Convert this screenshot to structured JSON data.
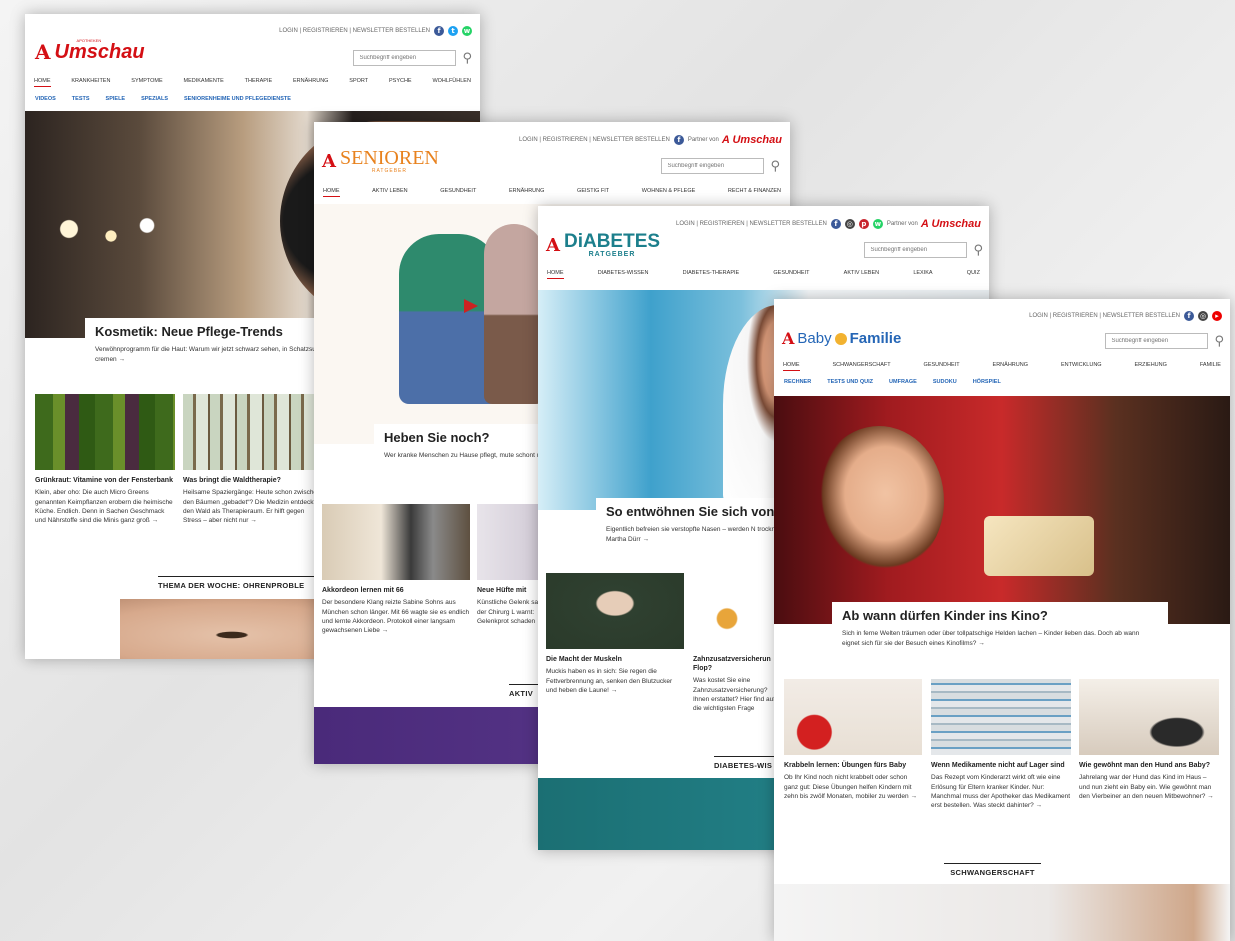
{
  "umschau": {
    "util": "LOGIN | REGISTRIEREN | NEWSLETTER BESTELLEN",
    "logo_small": "APOTHEKEN",
    "logo": "Umschau",
    "search_placeholder": "Suchbegriff eingeben",
    "nav": [
      "HOME",
      "KRANKHEITEN",
      "SYMPTOME",
      "MEDIKAMENTE",
      "THERAPIE",
      "ERNÄHRUNG",
      "SPORT",
      "PSYCHE",
      "WOHLFÜHLEN"
    ],
    "subnav": [
      "VIDEOS",
      "TESTS",
      "SPIELE",
      "SPEZIALS",
      "SENIORENHEIME UND PFLEGEDIENSTE"
    ],
    "hero_title": "Kosmetik: Neue Pflege-Trends",
    "hero_text": "Verwöhnprogramm für die Haut: Warum wir jetzt schwarz sehen, in Schatzsuche gehen können und Wirkstoffe trinken statt cremen →",
    "cards": [
      {
        "title": "Grünkraut: Vitamine von der Fensterbank",
        "text": "Klein, aber oho: Die auch Micro Greens genannten Keimpflanzen erobern die heimische Küche. Endlich. Denn in Sachen Geschmack und Nährstoffe sind die Minis ganz groß →"
      },
      {
        "title": "Was bringt die Waldtherapie?",
        "text": "Heilsame Spaziergänge: Heute schon zwischen den Bäumen „gebadet“? Die Medizin entdeckt den Wald als Therapieraum. Er hilft gegen Stress – aber nicht nur →"
      }
    ],
    "section": "THEMA DER WOCHE: OHRENPROBLE"
  },
  "senioren": {
    "util": "LOGIN | REGISTRIEREN | NEWSLETTER BESTELLEN",
    "partner": "Partner von",
    "partner_brand": "Umschau",
    "logo": "SENIOREN",
    "logo_sub": "RATGEBER",
    "search_placeholder": "Suchbegriff eingeben",
    "nav": [
      "HOME",
      "AKTIV LEBEN",
      "GESUNDHEIT",
      "ERNÄHRUNG",
      "GEISTIG FIT",
      "WOHNEN & PFLEGE",
      "RECHT & FINANZEN"
    ],
    "hero_title": "Heben Sie noch?",
    "hero_text": "Wer kranke Menschen zu Hause pflegt, mute schont und damit auch dem pflegebedürftige",
    "cards": [
      {
        "title": "Akkordeon lernen mit 66",
        "text": "Der besondere Klang reizte Sabine Sohns aus München schon länger. Mit 66 wagte sie es endlich und lernte Akkordeon. Protokoll einer langsam gewachsenen Liebe →"
      },
      {
        "title": "Neue Hüfte mit",
        "text": "Künstliche Gelenk sagt der Chirurg L warnt: Gelenkprot schaden →"
      }
    ],
    "section": "AKTIV"
  },
  "diabetes": {
    "util": "LOGIN | REGISTRIEREN | NEWSLETTER BESTELLEN",
    "partner": "Partner von",
    "partner_brand": "Umschau",
    "logo": "DiABETES",
    "logo_sub": "RATGEBER",
    "search_placeholder": "Suchbegriff eingeben",
    "nav": [
      "HOME",
      "DIABETES-WISSEN",
      "DIABETES-THERAPIE",
      "GESUNDHEIT",
      "AKTIV LEBEN",
      "LEXIKA",
      "QUIZ"
    ],
    "hero_title": "So entwöhnen Sie sich von",
    "hero_text": "Eigentlich befreien sie verstopfte Nasen – werden N trocknen sie die Nasenschleimhaut aus. Wie Sie von Apothekerin Maria Martha Dürr →",
    "cards": [
      {
        "title": "Die Macht der Muskeln",
        "text": "Muckis haben es in sich: Sie regen die Fettverbrennung an, senken den Blutzucker und heben die Laune! →"
      },
      {
        "title": "Zahnzusatzversicherun Flop?",
        "text": "Was kostet Sie eine Zahnzusatzversicherung? Ihnen erstattet? Hier find auf die wichtigsten Frage"
      }
    ],
    "section": "DIABETES-WIS"
  },
  "baby": {
    "util": "LOGIN | REGISTRIEREN | NEWSLETTER BESTELLEN",
    "logo_a": "Baby",
    "logo_b": "Familie",
    "search_placeholder": "Suchbegriff eingeben",
    "nav": [
      "HOME",
      "SCHWANGERSCHAFT",
      "GESUNDHEIT",
      "ERNÄHRUNG",
      "ENTWICKLUNG",
      "ERZIEHUNG",
      "FAMILIE"
    ],
    "subnav": [
      "RECHNER",
      "TESTS UND QUIZ",
      "UMFRAGE",
      "SUDOKU",
      "HÖRSPIEL"
    ],
    "hero_title": "Ab wann dürfen Kinder ins Kino?",
    "hero_text": "Sich in ferne Welten träumen oder über tollpatschige Helden lachen – Kinder lieben das. Doch ab wann eignet sich für sie der Besuch eines Kinofilms? →",
    "cards": [
      {
        "title": "Krabbeln lernen: Übungen fürs Baby",
        "text": "Ob Ihr Kind noch nicht krabbelt oder schon ganz gut: Diese Übungen helfen Kindern mit zehn bis zwölf Monaten, mobiler zu werden →"
      },
      {
        "title": "Wenn Medikamente nicht auf Lager sind",
        "text": "Das Rezept vom Kinderarzt wirkt oft wie eine Erlösung für Eltern kranker Kinder. Nur: Manchmal muss der Apotheker das Medikament erst bestellen. Was steckt dahinter? →"
      },
      {
        "title": "Wie gewöhnt man den Hund ans Baby?",
        "text": "Jahrelang war der Hund das Kind im Haus – und nun zieht ein Baby ein. Wie gewöhnt man den Vierbeiner an den neuen Mitbewohner? →"
      }
    ],
    "section": "SCHWANGERSCHAFT"
  },
  "colors": {
    "brand_red": "#d40f14",
    "link_blue": "#2566b6",
    "senioren_orange": "#e8821e",
    "diabetes_teal": "#1c7f8c"
  }
}
